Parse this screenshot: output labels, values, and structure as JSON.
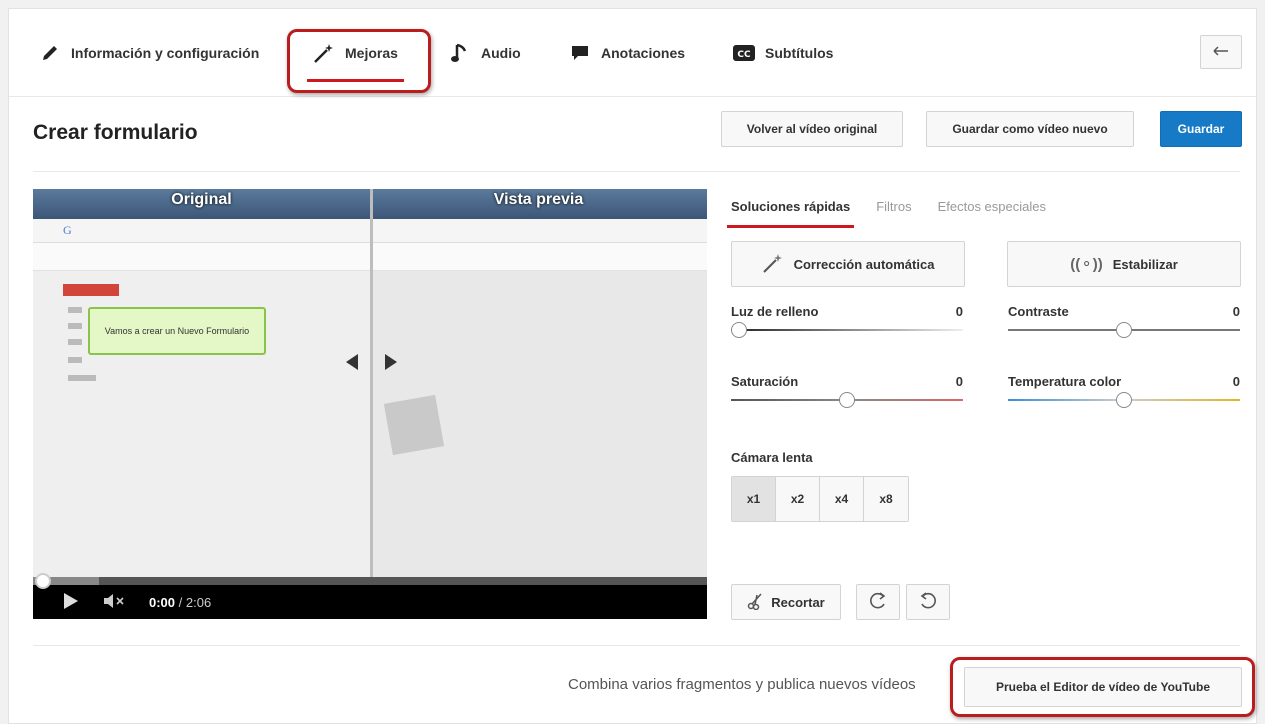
{
  "nav": {
    "items": [
      {
        "label": "Información y configuración",
        "icon": "pencil-icon"
      },
      {
        "label": "Mejoras",
        "icon": "magic-wand-icon",
        "active": true
      },
      {
        "label": "Audio",
        "icon": "music-note-icon"
      },
      {
        "label": "Anotaciones",
        "icon": "speech-bubble-icon"
      },
      {
        "label": "Subtítulos",
        "icon": "cc-icon"
      }
    ],
    "back_icon": "undo-arrow-icon"
  },
  "header": {
    "title": "Crear formulario",
    "revert_label": "Volver al vídeo original",
    "save_new_label": "Guardar como vídeo nuevo",
    "save_label": "Guardar"
  },
  "video": {
    "left_label": "Original",
    "right_label": "Vista previa",
    "tooltip": "Vamos a crear un Nuevo Formulario",
    "time_current": "0:00",
    "time_total": " / 2:06"
  },
  "panel": {
    "tabs": [
      "Soluciones rápidas",
      "Filtros",
      "Efectos especiales"
    ],
    "auto_fix_label": "Corrección automática",
    "stabilize_label": "Estabilizar",
    "sliders": [
      {
        "label": "Luz de relleno",
        "value": "0"
      },
      {
        "label": "Contraste",
        "value": "0"
      },
      {
        "label": "Saturación",
        "value": "0"
      },
      {
        "label": "Temperatura color",
        "value": "0"
      }
    ],
    "slow_motion_label": "Cámara lenta",
    "slow_options": [
      "x1",
      "x2",
      "x4",
      "x8"
    ],
    "trim_label": "Recortar"
  },
  "footer": {
    "text": "Combina varios fragmentos y publica nuevos vídeos",
    "editor_label": "Prueba el Editor de vídeo de YouTube"
  },
  "colors": {
    "accent": "#cc181e",
    "primary": "#167ac6",
    "highlight": "#b91d1d"
  }
}
